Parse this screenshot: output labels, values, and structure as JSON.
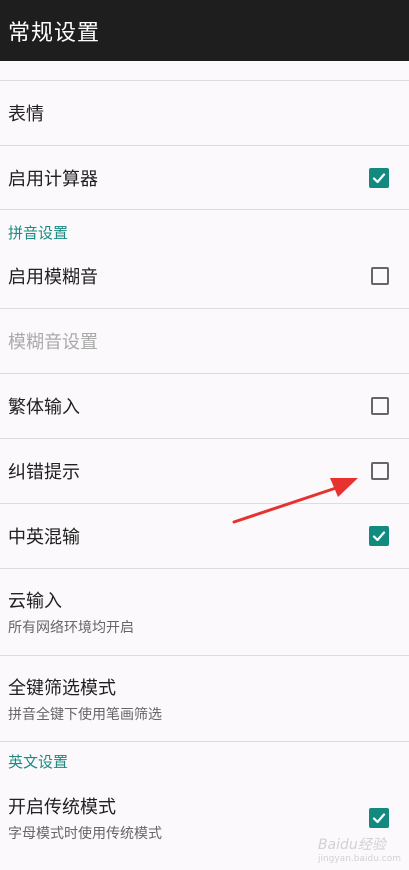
{
  "app_bar": {
    "title": "常规设置"
  },
  "rows": {
    "emoji": {
      "title": "表情"
    },
    "calculator": {
      "title": "启用计算器",
      "checked": true
    },
    "fuzzy": {
      "title": "启用模糊音",
      "checked": false
    },
    "fuzzy_settings": {
      "title": "模糊音设置"
    },
    "traditional": {
      "title": "繁体输入",
      "checked": false
    },
    "correction": {
      "title": "纠错提示",
      "checked": false
    },
    "mixed": {
      "title": "中英混输",
      "checked": true
    },
    "cloud": {
      "title": "云输入",
      "summary": "所有网络环境均开启"
    },
    "fullkey": {
      "title": "全键筛选模式",
      "summary": "拼音全键下使用笔画筛选"
    },
    "legacy": {
      "title": "开启传统模式",
      "summary": "字母模式时使用传统模式",
      "checked": true
    }
  },
  "sections": {
    "pinyin": "拼音设置",
    "english": "英文设置"
  },
  "watermark": {
    "text": "Baidu经验",
    "sub": "jingyan.baidu.com"
  },
  "colors": {
    "accent": "#138a80",
    "section": "#1c8a82",
    "appbar": "#1e1e1e",
    "arrow": "#e8322f"
  }
}
